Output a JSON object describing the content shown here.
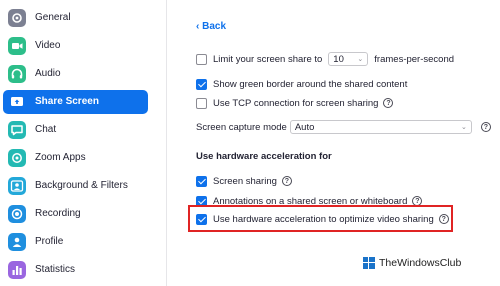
{
  "sidebar": {
    "items": [
      {
        "label": "General",
        "icon": "gear-icon",
        "color": "#7c8092",
        "active": false
      },
      {
        "label": "Video",
        "icon": "video-camera-icon",
        "color": "#2dbe8a",
        "active": false
      },
      {
        "label": "Audio",
        "icon": "headphones-icon",
        "color": "#2dbe8a",
        "active": false
      },
      {
        "label": "Share Screen",
        "icon": "share-screen-icon",
        "color": "#ffffff",
        "active": true
      },
      {
        "label": "Chat",
        "icon": "chat-bubble-icon",
        "color": "#23b9b3",
        "active": false
      },
      {
        "label": "Zoom Apps",
        "icon": "apps-icon",
        "color": "#23b9b3",
        "active": false
      },
      {
        "label": "Background & Filters",
        "icon": "person-background-icon",
        "color": "#23a8d9",
        "active": false
      },
      {
        "label": "Recording",
        "icon": "record-icon",
        "color": "#1f8fdf",
        "active": false
      },
      {
        "label": "Profile",
        "icon": "profile-icon",
        "color": "#1f8fdf",
        "active": false
      },
      {
        "label": "Statistics",
        "icon": "bar-chart-icon",
        "color": "#9a66e0",
        "active": false
      }
    ]
  },
  "main": {
    "back_label": "Back",
    "limit_share": {
      "label_before": "Limit your screen share to",
      "fps_value": "10",
      "label_after": "frames-per-second",
      "checked": false
    },
    "green_border": {
      "label": "Show green border around the shared content",
      "checked": true
    },
    "tcp": {
      "label": "Use TCP connection for screen sharing",
      "checked": false
    },
    "capture_mode": {
      "label": "Screen capture mode",
      "value": "Auto"
    },
    "hw_section_title": "Use hardware acceleration for",
    "hw_screen_sharing": {
      "label": "Screen sharing",
      "checked": true
    },
    "hw_annotations": {
      "label": "Annotations on a shared screen or whiteboard",
      "checked": true
    },
    "hw_optimize_video": {
      "label": "Use hardware acceleration to optimize video sharing",
      "checked": true
    }
  },
  "watermark": {
    "text": "TheWindowsClub"
  },
  "colors": {
    "accent": "#0e71eb",
    "highlight": "#e02424"
  }
}
